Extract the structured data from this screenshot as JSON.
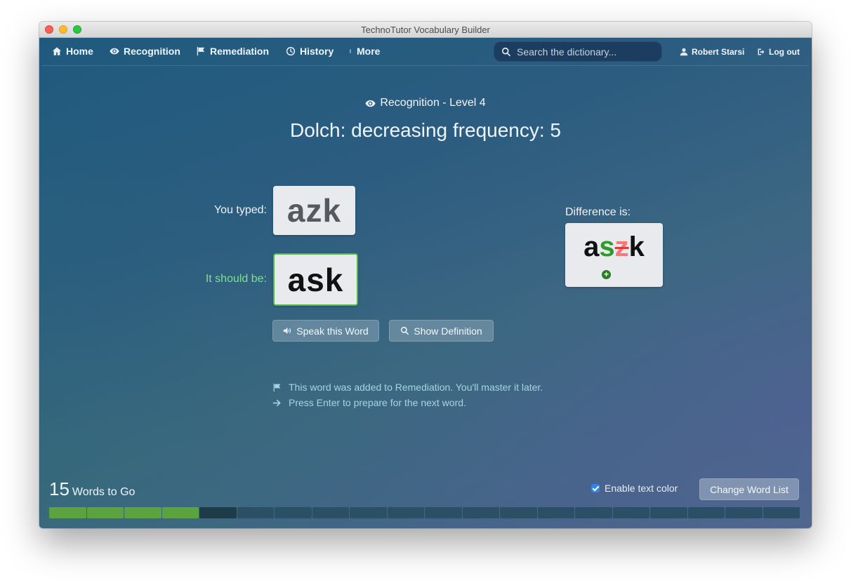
{
  "window": {
    "title": "TechnoTutor Vocabulary Builder"
  },
  "nav": {
    "items": [
      {
        "label": "Home",
        "icon": "home-icon"
      },
      {
        "label": "Recognition",
        "icon": "eye-icon"
      },
      {
        "label": "Remediation",
        "icon": "flag-icon"
      },
      {
        "label": "History",
        "icon": "clock-icon"
      },
      {
        "label": "More",
        "icon": "more-vertical-icon"
      }
    ],
    "search_placeholder": "Search the dictionary...",
    "user_name": "Robert Starsi",
    "logout_label": "Log out"
  },
  "exercise": {
    "mode": "Recognition - Level 4",
    "list_title": "Dolch: decreasing frequency: 5",
    "typed_label": "You typed:",
    "typed_word": "azk",
    "should_label": "It should be:",
    "correct_word": "ask",
    "difference_label": "Difference is:",
    "difference": [
      {
        "text": "a",
        "kind": "same"
      },
      {
        "text": "s",
        "kind": "added"
      },
      {
        "text": "z",
        "kind": "removed"
      },
      {
        "text": "k",
        "kind": "same"
      }
    ],
    "speak_button": "Speak this Word",
    "definition_button": "Show Definition",
    "notes": [
      {
        "icon": "flag-icon",
        "text": "This word was added to Remediation. You'll master it later."
      },
      {
        "icon": "arrow-right-icon",
        "text": "Press Enter to prepare for the next word."
      }
    ]
  },
  "footer": {
    "words_count": "15",
    "words_suffix": "Words to Go",
    "text_color_label": "Enable text color",
    "text_color_enabled": true,
    "change_list_button": "Change Word List"
  },
  "progress": {
    "total": 20,
    "completed": 4,
    "current_index": 4
  },
  "colors": {
    "accent_green": "#53b848",
    "error_red": "#f37a7a",
    "added_green": "#2f9a2a",
    "progress_done": "#5aa33f",
    "progress_current": "#1c3c48",
    "progress_remaining": "#2b5066"
  }
}
